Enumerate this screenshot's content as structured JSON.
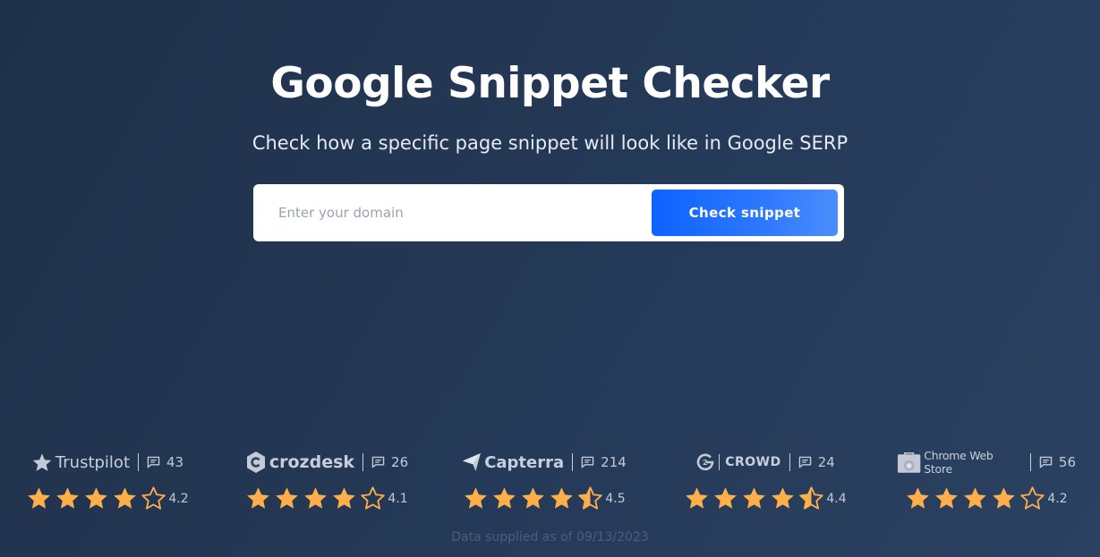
{
  "hero": {
    "title": "Google Snippet Checker",
    "subtitle": "Check how a specific page snippet will look like in Google SERP"
  },
  "search": {
    "placeholder": "Enter your domain",
    "value": "",
    "button_label": "Check snippet"
  },
  "colors": {
    "star": "#ffaf4a",
    "button": "#1a6cff",
    "background": "#253a58"
  },
  "reviews": [
    {
      "brand": "Trustpilot",
      "icon": "trustpilot-star-icon",
      "count": "43",
      "rating": "4.2",
      "stars": 4.2
    },
    {
      "brand": "crozdesk",
      "icon": "crozdesk-logo-icon",
      "count": "26",
      "rating": "4.1",
      "stars": 4.1
    },
    {
      "brand": "Capterra",
      "icon": "capterra-arrow-icon",
      "count": "214",
      "rating": "4.5",
      "stars": 4.5
    },
    {
      "brand": "CROWD",
      "icon": "g2-logo-icon",
      "count": "24",
      "rating": "4.4",
      "stars": 4.4
    },
    {
      "brand": "Chrome Web Store",
      "icon": "chrome-web-store-icon",
      "count": "56",
      "rating": "4.2",
      "stars": 4.2
    }
  ],
  "footnote": "Data supplied as of 09/13/2023"
}
